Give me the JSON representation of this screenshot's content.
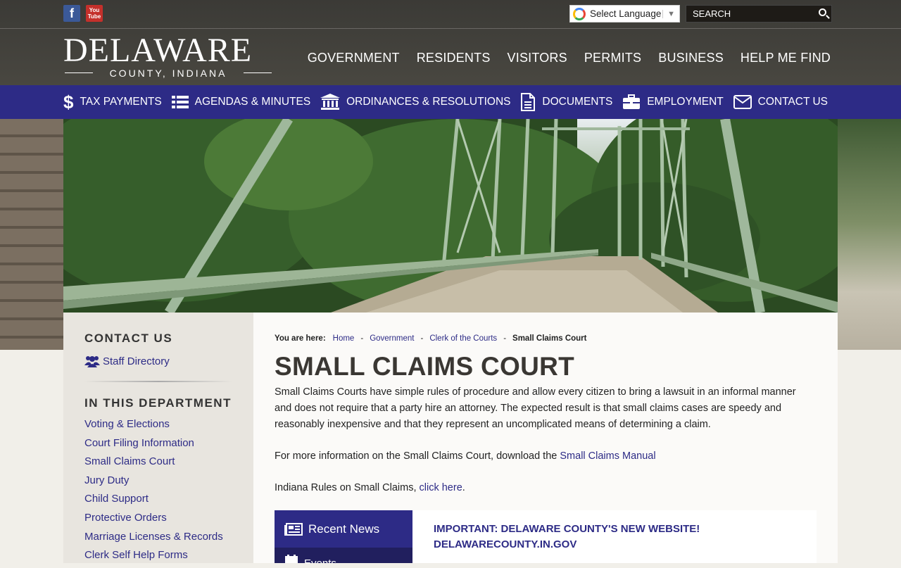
{
  "social": {
    "facebook": "f",
    "youtube_top": "You",
    "youtube_bottom": "Tube"
  },
  "language": {
    "label": "Select Language"
  },
  "search": {
    "placeholder": "SEARCH"
  },
  "logo": {
    "main": "DELAWARE",
    "sub": "COUNTY, INDIANA"
  },
  "main_nav": [
    "GOVERNMENT",
    "RESIDENTS",
    "VISITORS",
    "PERMITS",
    "BUSINESS",
    "HELP ME FIND"
  ],
  "sub_nav": [
    {
      "label": "TAX PAYMENTS",
      "icon": "dollar-icon"
    },
    {
      "label": "AGENDAS & MINUTES",
      "icon": "list-icon"
    },
    {
      "label": "ORDINANCES & RESOLUTIONS",
      "icon": "institution-icon"
    },
    {
      "label": "DOCUMENTS",
      "icon": "document-icon"
    },
    {
      "label": "EMPLOYMENT",
      "icon": "briefcase-icon"
    },
    {
      "label": "CONTACT US",
      "icon": "envelope-icon"
    }
  ],
  "sidebar": {
    "contact_heading": "CONTACT US",
    "staff_directory": "Staff Directory",
    "dept_heading": "IN THIS DEPARTMENT",
    "links": [
      "Voting & Elections",
      "Court Filing Information",
      "Small Claims Court",
      "Jury Duty",
      "Child Support",
      "Protective Orders",
      "Marriage Licenses & Records",
      "Clerk Self Help Forms"
    ]
  },
  "breadcrumb": {
    "label": "You are here:",
    "items": [
      "Home",
      "Government",
      "Clerk of the Courts"
    ],
    "current": "Small Claims Court",
    "separator": "-"
  },
  "page": {
    "title": "SMALL CLAIMS COURT",
    "paragraph1": "Small Claims Courts have simple rules of procedure and allow every citizen to bring a lawsuit in an informal manner and does not require that a party hire an attorney.  The expected result is that small claims cases are speedy and reasonably inexpensive and that they represent an uncomplicated means of determining a claim.",
    "paragraph2_text": "For more information on the Small Claims Court, download the ",
    "paragraph2_link": "Small Claims Manual",
    "paragraph3_text": "Indiana Rules on Small Claims, ",
    "paragraph3_link": "click here",
    "paragraph3_end": "."
  },
  "news": {
    "tab_recent": "Recent News",
    "tab_events": "Events",
    "headline_line1": "IMPORTANT: DELAWARE COUNTY'S NEW WEBSITE!",
    "headline_line2": "DELAWARECOUNTY.IN.GOV"
  },
  "colors": {
    "brand_blue": "#2d2b86",
    "dark_blue": "#211f5e"
  }
}
